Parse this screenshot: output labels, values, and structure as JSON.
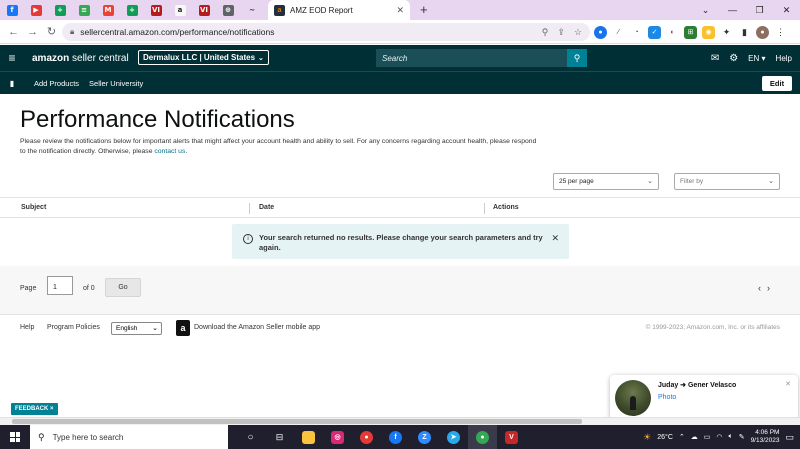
{
  "browser": {
    "favicons": [
      {
        "name": "facebook-icon",
        "color": "#1877f2",
        "glyph": "f"
      },
      {
        "name": "youtube-icon",
        "color": "#e53935",
        "glyph": "▶"
      },
      {
        "name": "sheets-icon",
        "color": "#0f9d58",
        "glyph": "+"
      },
      {
        "name": "forms-icon",
        "color": "#34a853",
        "glyph": "≡"
      },
      {
        "name": "gmail-icon",
        "color": "#ea4335",
        "glyph": "M"
      },
      {
        "name": "sheets-icon-2",
        "color": "#0f9d58",
        "glyph": "+"
      },
      {
        "name": "vivaldi-icon",
        "color": "#b71c1c",
        "glyph": "VI"
      },
      {
        "name": "amazon-icon",
        "color": "#f7f7f7",
        "glyph": "a"
      },
      {
        "name": "vivaldi-icon-2",
        "color": "#b71c1c",
        "glyph": "VI"
      },
      {
        "name": "globe-icon",
        "color": "#5f6368",
        "glyph": "⊕"
      },
      {
        "name": "tiny-icon",
        "color": "#e8d5f0",
        "glyph": "~"
      }
    ],
    "active_tab_title": "AMZ EOD Report",
    "url": "sellercentral.amazon.com/performance/notifications",
    "new_tab_glyph": "+"
  },
  "header": {
    "logo_main": "amazon",
    "logo_sub": " seller central",
    "account_label": "Dermalux LLC | United States",
    "search_placeholder": "Search",
    "lang": "EN",
    "help": "Help"
  },
  "subnav": {
    "links": [
      "Add Products",
      "Seller University"
    ],
    "edit_label": "Edit"
  },
  "page": {
    "title": "Performance Notifications",
    "description": "Please review the notifications below for important alerts that might affect your account health and ability to sell. For any concerns regarding account health, please respond to the notification directly. Otherwise, please ",
    "contact_link": "contact us",
    "description_end": ".",
    "per_page": "25 per page",
    "filter_placeholder": "Filter by"
  },
  "table": {
    "columns": [
      "Subject",
      "Date",
      "Actions"
    ],
    "empty_message": "Your search returned no results. Please change your search parameters and try again."
  },
  "pager": {
    "page_label": "Page",
    "page_value": "1",
    "of_label": "of 0",
    "go_label": "Go"
  },
  "footer": {
    "help": "Help",
    "policies": "Program Policies",
    "language": "English",
    "app_text": "Download the Amazon Seller mobile app",
    "copyright": "© 1999-2023, Amazon.com, Inc. or its affiliates"
  },
  "feedback_label": "FEEDBACK ×",
  "chat": {
    "title": "Juday ➜ Gener Velasco",
    "subtitle": "Photo"
  },
  "taskbar": {
    "search_text": "Type here to search",
    "weather": "26°C",
    "time": "4:06 PM",
    "date": "9/13/2023"
  }
}
